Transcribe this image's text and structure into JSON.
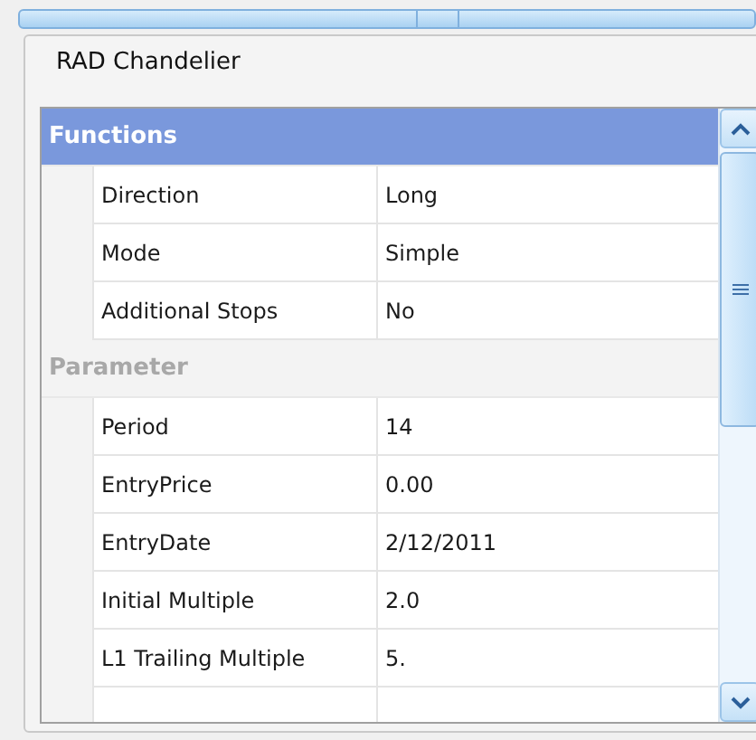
{
  "panel": {
    "title": "RAD Chandelier"
  },
  "categories": [
    {
      "name": "Functions",
      "selected": true,
      "properties": [
        {
          "name": "Direction",
          "value": "Long"
        },
        {
          "name": "Mode",
          "value": "Simple"
        },
        {
          "name": "Additional Stops",
          "value": "No"
        }
      ]
    },
    {
      "name": "Parameter",
      "selected": false,
      "properties": [
        {
          "name": "Period",
          "value": "14"
        },
        {
          "name": "EntryPrice",
          "value": "0.00"
        },
        {
          "name": "EntryDate",
          "value": "2/12/2011"
        },
        {
          "name": "Initial Multiple",
          "value": "2.0"
        },
        {
          "name": "L1 Trailing Multiple",
          "value": "5."
        }
      ]
    }
  ]
}
